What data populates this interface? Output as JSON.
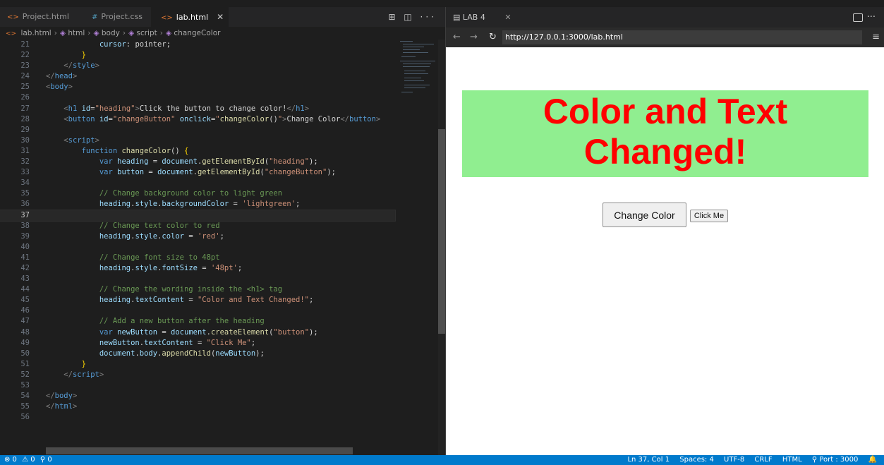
{
  "editor": {
    "tabs": [
      {
        "icon": "<>",
        "label": "Project.html"
      },
      {
        "icon": "#",
        "label": "Project.css"
      },
      {
        "icon": "<>",
        "label": "lab.html",
        "close": "✕"
      }
    ],
    "actions": "⊞ ◫ ···",
    "breadcrumb": [
      "lab.html",
      "html",
      "body",
      "script",
      "changeColor"
    ],
    "current_line": 37,
    "lines": [
      {
        "n": "21",
        "tokens": [
          [
            "            ",
            "tok-text"
          ],
          [
            "cursor",
            "tok-attr"
          ],
          [
            ": pointer;",
            "tok-text"
          ]
        ]
      },
      {
        "n": "22",
        "tokens": [
          [
            "        ",
            "tok-text"
          ],
          [
            "}",
            "tok-br"
          ]
        ]
      },
      {
        "n": "23",
        "tokens": [
          [
            "    ",
            "tok-text"
          ],
          [
            "</",
            "tok-ang"
          ],
          [
            "style",
            "tok-tag"
          ],
          [
            ">",
            "tok-ang"
          ]
        ]
      },
      {
        "n": "24",
        "tokens": [
          [
            "</",
            "tok-ang"
          ],
          [
            "head",
            "tok-tag"
          ],
          [
            ">",
            "tok-ang"
          ]
        ]
      },
      {
        "n": "25",
        "tokens": [
          [
            "<",
            "tok-ang"
          ],
          [
            "body",
            "tok-tag"
          ],
          [
            ">",
            "tok-ang"
          ]
        ]
      },
      {
        "n": "26",
        "tokens": []
      },
      {
        "n": "27",
        "tokens": [
          [
            "    ",
            "tok-text"
          ],
          [
            "<",
            "tok-ang"
          ],
          [
            "h1",
            "tok-tag"
          ],
          [
            " ",
            "tok-text"
          ],
          [
            "id",
            "tok-attr"
          ],
          [
            "=",
            "tok-text"
          ],
          [
            "\"heading\"",
            "tok-str"
          ],
          [
            ">",
            "tok-ang"
          ],
          [
            "Click the button to change color!",
            "tok-text"
          ],
          [
            "</",
            "tok-ang"
          ],
          [
            "h1",
            "tok-tag"
          ],
          [
            ">",
            "tok-ang"
          ]
        ]
      },
      {
        "n": "28",
        "tokens": [
          [
            "    ",
            "tok-text"
          ],
          [
            "<",
            "tok-ang"
          ],
          [
            "button",
            "tok-tag"
          ],
          [
            " ",
            "tok-text"
          ],
          [
            "id",
            "tok-attr"
          ],
          [
            "=",
            "tok-text"
          ],
          [
            "\"changeButton\"",
            "tok-str"
          ],
          [
            " ",
            "tok-text"
          ],
          [
            "onclick",
            "tok-attr"
          ],
          [
            "=",
            "tok-text"
          ],
          [
            "\"",
            "tok-str"
          ],
          [
            "changeColor",
            "tok-fn"
          ],
          [
            "()",
            "tok-text"
          ],
          [
            "\"",
            "tok-str"
          ],
          [
            ">",
            "tok-ang"
          ],
          [
            "Change Color",
            "tok-text"
          ],
          [
            "</",
            "tok-ang"
          ],
          [
            "button",
            "tok-tag"
          ],
          [
            ">",
            "tok-ang"
          ]
        ]
      },
      {
        "n": "29",
        "tokens": []
      },
      {
        "n": "30",
        "tokens": [
          [
            "    ",
            "tok-text"
          ],
          [
            "<",
            "tok-ang"
          ],
          [
            "script",
            "tok-tag"
          ],
          [
            ">",
            "tok-ang"
          ]
        ]
      },
      {
        "n": "31",
        "tokens": [
          [
            "        ",
            "tok-text"
          ],
          [
            "function",
            "tok-kw"
          ],
          [
            " ",
            "tok-text"
          ],
          [
            "changeColor",
            "tok-fn"
          ],
          [
            "() ",
            "tok-text"
          ],
          [
            "{",
            "tok-br"
          ]
        ]
      },
      {
        "n": "32",
        "tokens": [
          [
            "            ",
            "tok-text"
          ],
          [
            "var",
            "tok-kw"
          ],
          [
            " ",
            "tok-text"
          ],
          [
            "heading",
            "tok-var"
          ],
          [
            " = ",
            "tok-text"
          ],
          [
            "document",
            "tok-var"
          ],
          [
            ".",
            "tok-text"
          ],
          [
            "getElementById",
            "tok-fn"
          ],
          [
            "(",
            "tok-text"
          ],
          [
            "\"heading\"",
            "tok-str"
          ],
          [
            ");",
            "tok-text"
          ]
        ]
      },
      {
        "n": "33",
        "tokens": [
          [
            "            ",
            "tok-text"
          ],
          [
            "var",
            "tok-kw"
          ],
          [
            " ",
            "tok-text"
          ],
          [
            "button",
            "tok-var"
          ],
          [
            " = ",
            "tok-text"
          ],
          [
            "document",
            "tok-var"
          ],
          [
            ".",
            "tok-text"
          ],
          [
            "getElementById",
            "tok-fn"
          ],
          [
            "(",
            "tok-text"
          ],
          [
            "\"changeButton\"",
            "tok-str"
          ],
          [
            ");",
            "tok-text"
          ]
        ]
      },
      {
        "n": "34",
        "tokens": []
      },
      {
        "n": "35",
        "tokens": [
          [
            "            ",
            "tok-text"
          ],
          [
            "// Change background color to light green",
            "tok-com"
          ]
        ]
      },
      {
        "n": "36",
        "tokens": [
          [
            "            ",
            "tok-text"
          ],
          [
            "heading",
            "tok-var"
          ],
          [
            ".",
            "tok-text"
          ],
          [
            "style",
            "tok-var"
          ],
          [
            ".",
            "tok-text"
          ],
          [
            "backgroundColor",
            "tok-var"
          ],
          [
            " = ",
            "tok-text"
          ],
          [
            "'lightgreen'",
            "tok-str"
          ],
          [
            ";",
            "tok-text"
          ]
        ]
      },
      {
        "n": "37",
        "tokens": []
      },
      {
        "n": "38",
        "tokens": [
          [
            "            ",
            "tok-text"
          ],
          [
            "// Change text color to red",
            "tok-com"
          ]
        ]
      },
      {
        "n": "39",
        "tokens": [
          [
            "            ",
            "tok-text"
          ],
          [
            "heading",
            "tok-var"
          ],
          [
            ".",
            "tok-text"
          ],
          [
            "style",
            "tok-var"
          ],
          [
            ".",
            "tok-text"
          ],
          [
            "color",
            "tok-var"
          ],
          [
            " = ",
            "tok-text"
          ],
          [
            "'red'",
            "tok-str"
          ],
          [
            ";",
            "tok-text"
          ]
        ]
      },
      {
        "n": "40",
        "tokens": []
      },
      {
        "n": "41",
        "tokens": [
          [
            "            ",
            "tok-text"
          ],
          [
            "// Change font size to 48pt",
            "tok-com"
          ]
        ]
      },
      {
        "n": "42",
        "tokens": [
          [
            "            ",
            "tok-text"
          ],
          [
            "heading",
            "tok-var"
          ],
          [
            ".",
            "tok-text"
          ],
          [
            "style",
            "tok-var"
          ],
          [
            ".",
            "tok-text"
          ],
          [
            "fontSize",
            "tok-var"
          ],
          [
            " = ",
            "tok-text"
          ],
          [
            "'48pt'",
            "tok-str"
          ],
          [
            ";",
            "tok-text"
          ]
        ]
      },
      {
        "n": "43",
        "tokens": []
      },
      {
        "n": "44",
        "tokens": [
          [
            "            ",
            "tok-text"
          ],
          [
            "// Change the wording inside the <h1> tag",
            "tok-com"
          ]
        ]
      },
      {
        "n": "45",
        "tokens": [
          [
            "            ",
            "tok-text"
          ],
          [
            "heading",
            "tok-var"
          ],
          [
            ".",
            "tok-text"
          ],
          [
            "textContent",
            "tok-var"
          ],
          [
            " = ",
            "tok-text"
          ],
          [
            "\"Color and Text Changed!\"",
            "tok-str"
          ],
          [
            ";",
            "tok-text"
          ]
        ]
      },
      {
        "n": "46",
        "tokens": []
      },
      {
        "n": "47",
        "tokens": [
          [
            "            ",
            "tok-text"
          ],
          [
            "// Add a new button after the heading",
            "tok-com"
          ]
        ]
      },
      {
        "n": "48",
        "tokens": [
          [
            "            ",
            "tok-text"
          ],
          [
            "var",
            "tok-kw"
          ],
          [
            " ",
            "tok-text"
          ],
          [
            "newButton",
            "tok-var"
          ],
          [
            " = ",
            "tok-text"
          ],
          [
            "document",
            "tok-var"
          ],
          [
            ".",
            "tok-text"
          ],
          [
            "createElement",
            "tok-fn"
          ],
          [
            "(",
            "tok-text"
          ],
          [
            "\"button\"",
            "tok-str"
          ],
          [
            ");",
            "tok-text"
          ]
        ]
      },
      {
        "n": "49",
        "tokens": [
          [
            "            ",
            "tok-text"
          ],
          [
            "newButton",
            "tok-var"
          ],
          [
            ".",
            "tok-text"
          ],
          [
            "textContent",
            "tok-var"
          ],
          [
            " = ",
            "tok-text"
          ],
          [
            "\"Click Me\"",
            "tok-str"
          ],
          [
            ";",
            "tok-text"
          ]
        ]
      },
      {
        "n": "50",
        "tokens": [
          [
            "            ",
            "tok-text"
          ],
          [
            "document",
            "tok-var"
          ],
          [
            ".",
            "tok-text"
          ],
          [
            "body",
            "tok-var"
          ],
          [
            ".",
            "tok-text"
          ],
          [
            "appendChild",
            "tok-fn"
          ],
          [
            "(",
            "tok-text"
          ],
          [
            "newButton",
            "tok-var"
          ],
          [
            ");",
            "tok-text"
          ]
        ]
      },
      {
        "n": "51",
        "tokens": [
          [
            "        ",
            "tok-text"
          ],
          [
            "}",
            "tok-br"
          ]
        ]
      },
      {
        "n": "52",
        "tokens": [
          [
            "    ",
            "tok-text"
          ],
          [
            "</",
            "tok-ang"
          ],
          [
            "script",
            "tok-tag"
          ],
          [
            ">",
            "tok-ang"
          ]
        ]
      },
      {
        "n": "53",
        "tokens": []
      },
      {
        "n": "54",
        "tokens": [
          [
            "</",
            "tok-ang"
          ],
          [
            "body",
            "tok-tag"
          ],
          [
            ">",
            "tok-ang"
          ]
        ]
      },
      {
        "n": "55",
        "tokens": [
          [
            "</",
            "tok-ang"
          ],
          [
            "html",
            "tok-tag"
          ],
          [
            ">",
            "tok-ang"
          ]
        ]
      },
      {
        "n": "56",
        "tokens": []
      }
    ]
  },
  "browser": {
    "tab_icon": "▤",
    "tab_label": "LAB 4",
    "tab_close": "✕",
    "more": "···",
    "back": "←",
    "forward": "→",
    "reload": "↻",
    "url": "http://127.0.0.1:3000/lab.html",
    "menu": "≡",
    "page": {
      "heading": "Color and Text Changed!",
      "heading_color": "#ff0000",
      "heading_bg": "#90ee90",
      "button_label": "Change Color",
      "new_button_label": "Click Me"
    }
  },
  "statusbar": {
    "errors": "⊗ 0",
    "warnings": "⚠ 0",
    "ports": "⚲ 0",
    "position": "Ln 37, Col 1",
    "spaces": "Spaces: 4",
    "encoding": "UTF-8",
    "eol": "CRLF",
    "language": "HTML",
    "port": "⚲ Port : 3000",
    "bell": "🔔"
  }
}
